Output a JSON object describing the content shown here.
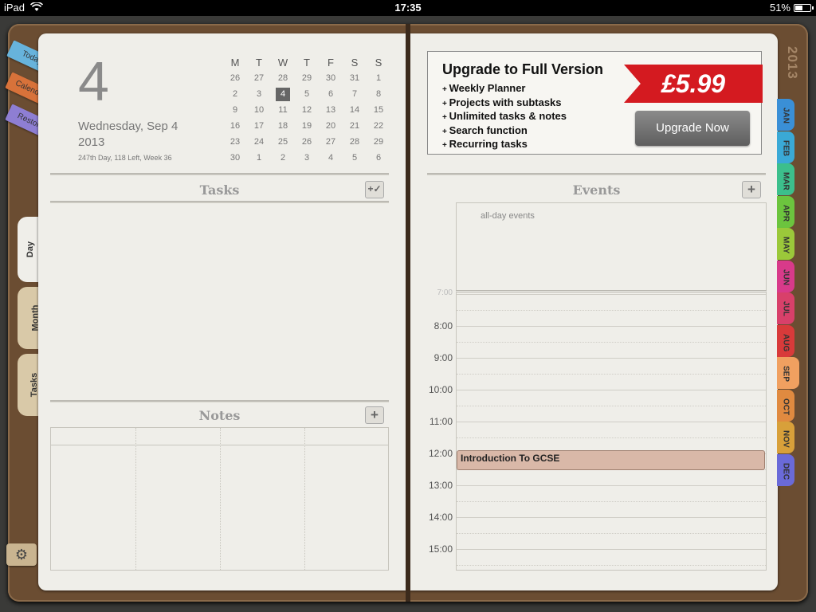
{
  "status": {
    "device": "iPad",
    "time": "17:35",
    "battery": "51%"
  },
  "cover": {
    "year": "2013"
  },
  "stickies": [
    "Today",
    "Calendar",
    "Restore"
  ],
  "view_tabs": [
    "Day",
    "Month",
    "Tasks"
  ],
  "day": {
    "number": "4",
    "weekday": "Wednesday, Sep 4",
    "year": "2013",
    "info": "247th Day, 118 Left, Week 36"
  },
  "minical": {
    "headers": [
      "M",
      "T",
      "W",
      "T",
      "F",
      "S",
      "S"
    ],
    "rows": [
      [
        "26",
        "27",
        "28",
        "29",
        "30",
        "31",
        "1"
      ],
      [
        "2",
        "3",
        "4",
        "5",
        "6",
        "7",
        "8"
      ],
      [
        "9",
        "10",
        "11",
        "12",
        "13",
        "14",
        "15"
      ],
      [
        "16",
        "17",
        "18",
        "19",
        "20",
        "21",
        "22"
      ],
      [
        "23",
        "24",
        "25",
        "26",
        "27",
        "28",
        "29"
      ],
      [
        "30",
        "1",
        "2",
        "3",
        "4",
        "5",
        "6"
      ]
    ],
    "selected": "4"
  },
  "sections": {
    "tasks": "Tasks",
    "notes": "Notes",
    "events": "Events"
  },
  "upgrade": {
    "title": "Upgrade to Full Version",
    "features": [
      "Weekly Planner",
      "Projects with subtasks",
      "Unlimited tasks & notes",
      "Search function",
      "Recurring tasks"
    ],
    "price": "£5.99",
    "button": "Upgrade Now"
  },
  "events": {
    "allday_label": "all-day events",
    "hours": [
      "7:00",
      "8:00",
      "9:00",
      "10:00",
      "11:00",
      "12:00",
      "13:00",
      "14:00",
      "15:00"
    ],
    "items": [
      {
        "title": "Introduction To GCSE",
        "start": "12:00",
        "color": "#d9b8a8"
      }
    ]
  },
  "months": [
    {
      "label": "JAN",
      "color": "#3a8fd6"
    },
    {
      "label": "FEB",
      "color": "#3aa9d6"
    },
    {
      "label": "MAR",
      "color": "#3cbf8c"
    },
    {
      "label": "APR",
      "color": "#6cc43e"
    },
    {
      "label": "MAY",
      "color": "#9bc83a"
    },
    {
      "label": "JUN",
      "color": "#d83a8a"
    },
    {
      "label": "JUL",
      "color": "#d8406a"
    },
    {
      "label": "AUG",
      "color": "#d83a3a"
    },
    {
      "label": "SEP",
      "color": "#f0a060"
    },
    {
      "label": "OCT",
      "color": "#e08a40"
    },
    {
      "label": "NOV",
      "color": "#d8a03a"
    },
    {
      "label": "DEC",
      "color": "#6a6ad8"
    }
  ],
  "active_month": "SEP"
}
